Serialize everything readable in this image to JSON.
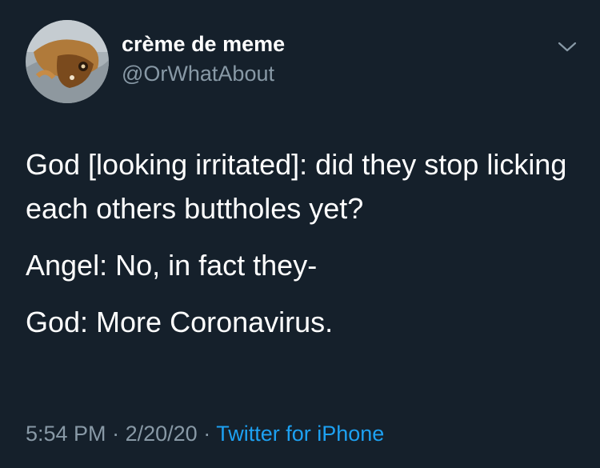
{
  "tweet": {
    "display_name": "crème de meme",
    "handle": "@OrWhatAbout",
    "paragraphs": [
      "God [looking irritated]: did they stop licking each others buttholes yet?",
      "Angel: No, in fact they-",
      "God: More Coronavirus."
    ],
    "time": "5:54 PM",
    "separator": "·",
    "date": "2/20/20",
    "source": "Twitter for iPhone"
  },
  "icons": {
    "menu": "chevron-down-icon"
  },
  "colors": {
    "background": "#15202b",
    "primary_text": "#ffffff",
    "secondary_text": "#8899a6",
    "link": "#1da1f2"
  }
}
